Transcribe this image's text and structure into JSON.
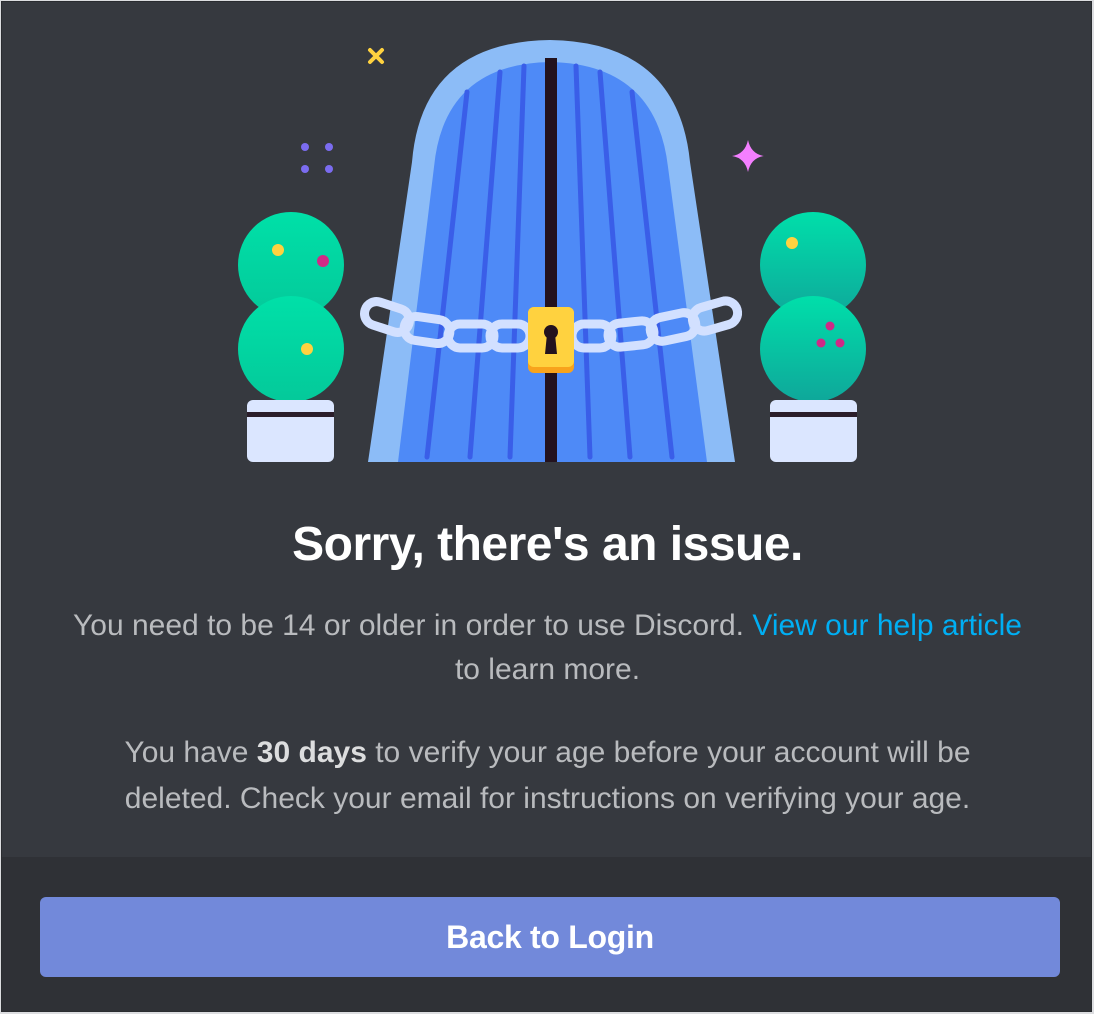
{
  "dialog": {
    "title": "Sorry, there's an issue.",
    "message_prefix": "You need to be 14 or older in order to use Discord. ",
    "help_link": "View our help article",
    "message_suffix": " to learn more.",
    "notice_prefix": "You have ",
    "notice_bold": "30 days",
    "notice_suffix": " to verify your age before your account will be deleted. Check your email for instructions on verifying your age."
  },
  "footer": {
    "back_label": "Back to Login"
  },
  "colors": {
    "background": "#36393f",
    "footer": "#2f3136",
    "button": "#7289da",
    "link": "#00aff4",
    "door": "#4e8af7",
    "door_frame": "#8cbcf7",
    "lock": "#ffd23f",
    "topiary": "#00d9a8"
  }
}
